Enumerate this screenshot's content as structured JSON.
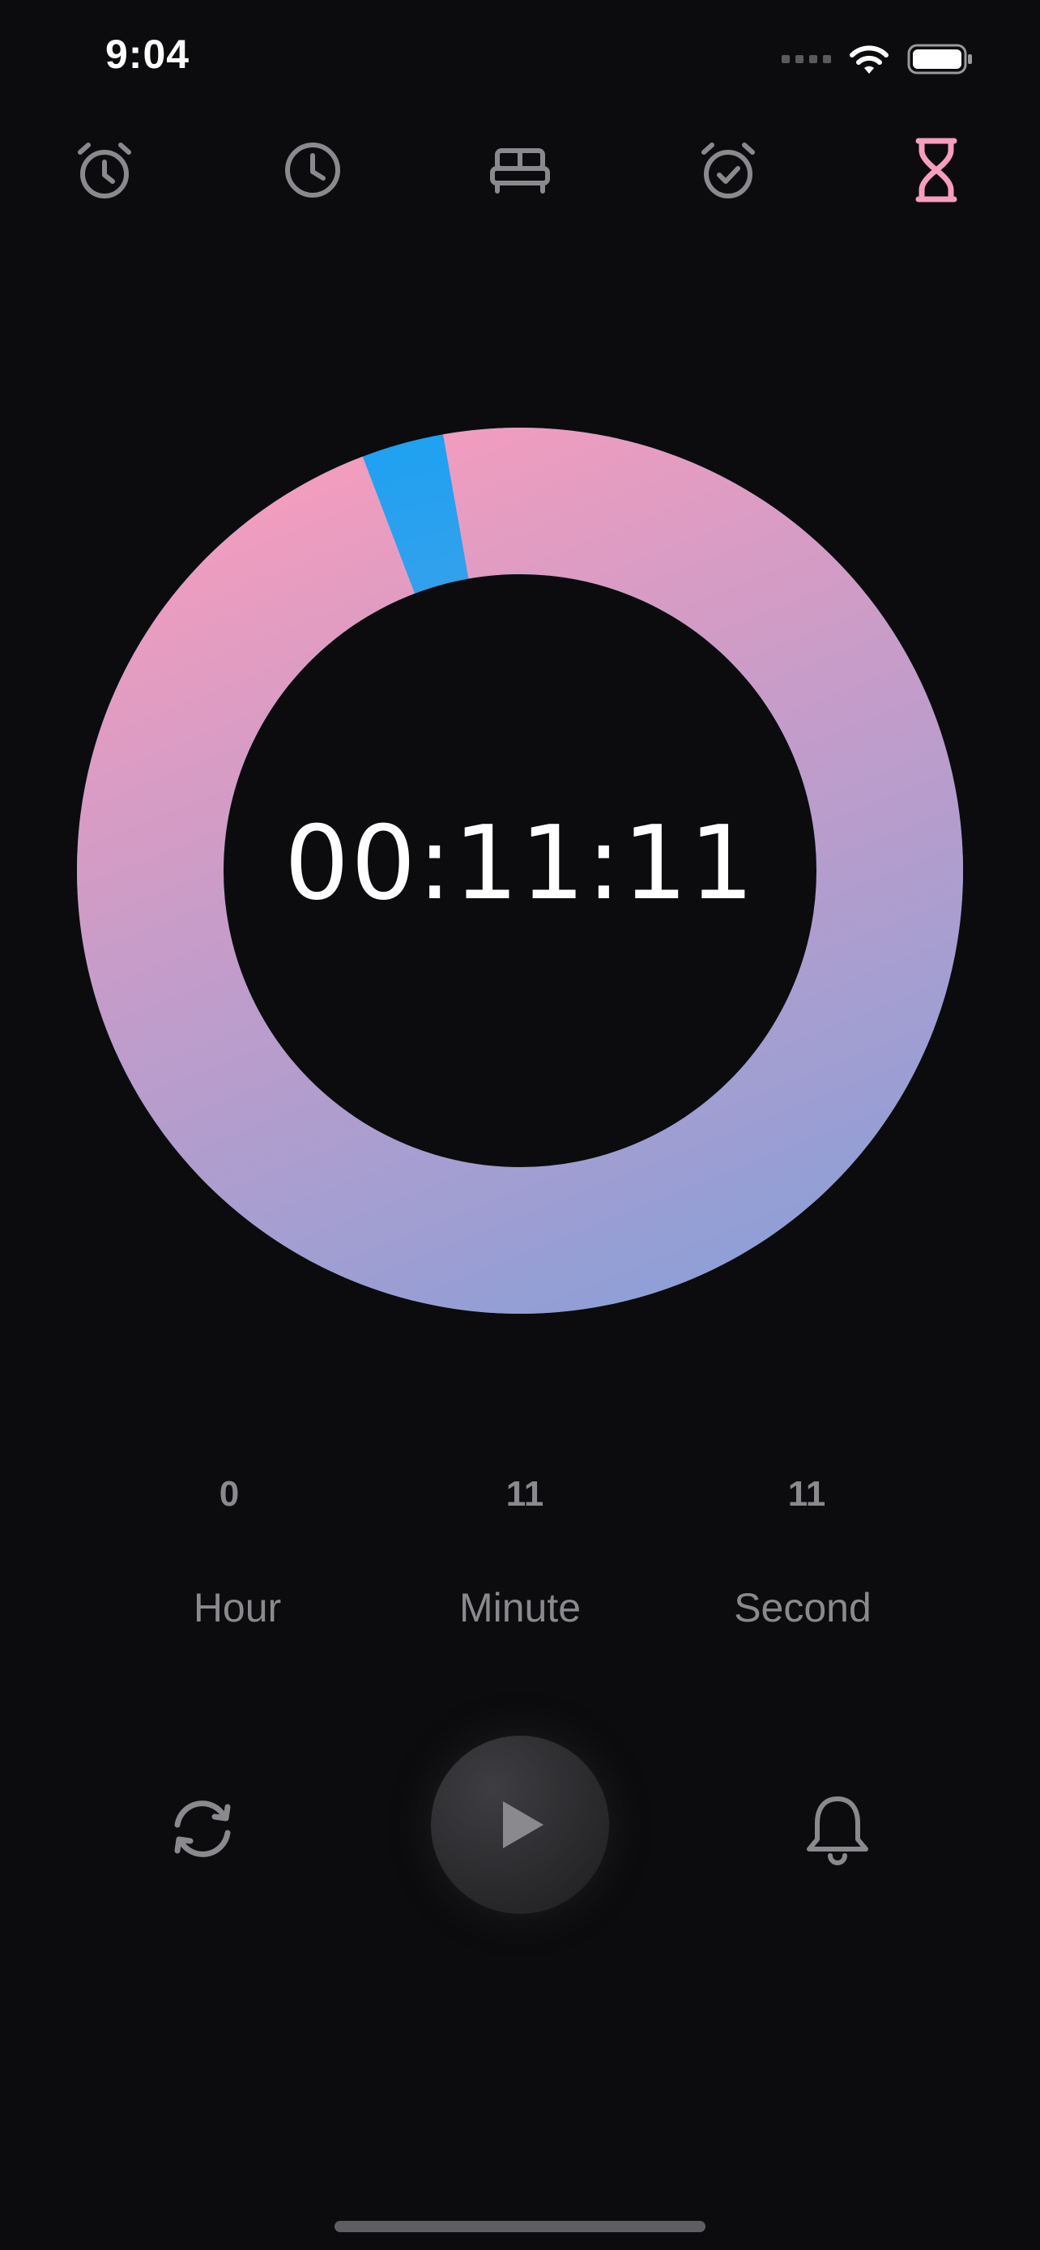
{
  "status_bar": {
    "time": "9:04"
  },
  "tabs": [
    {
      "name": "alarm",
      "icon": "alarm-clock-icon",
      "active": false
    },
    {
      "name": "world-clock",
      "icon": "clock-icon",
      "active": false
    },
    {
      "name": "bedtime",
      "icon": "bed-icon",
      "active": false
    },
    {
      "name": "alarm-check",
      "icon": "alarm-check-icon",
      "active": false
    },
    {
      "name": "timer",
      "icon": "hourglass-icon",
      "active": true
    }
  ],
  "timer": {
    "display": "00:11:11",
    "progress_remaining": 0.97,
    "ring_colors": {
      "blue": "#1da1f2",
      "pink": "#f79ebe",
      "lavender": "#a79fd0",
      "periwinkle": "#7f9ad8"
    }
  },
  "picker": {
    "hour": {
      "value": "0",
      "label": "Hour"
    },
    "minute": {
      "value": "11",
      "label": "Minute"
    },
    "second": {
      "value": "11",
      "label": "Second"
    }
  },
  "controls": {
    "reset_icon": "refresh-icon",
    "play_icon": "play-icon",
    "sound_icon": "bell-icon"
  },
  "colors": {
    "background": "#0c0c0e",
    "icon_inactive": "#8a8a8e",
    "accent": "#f79ebe"
  }
}
